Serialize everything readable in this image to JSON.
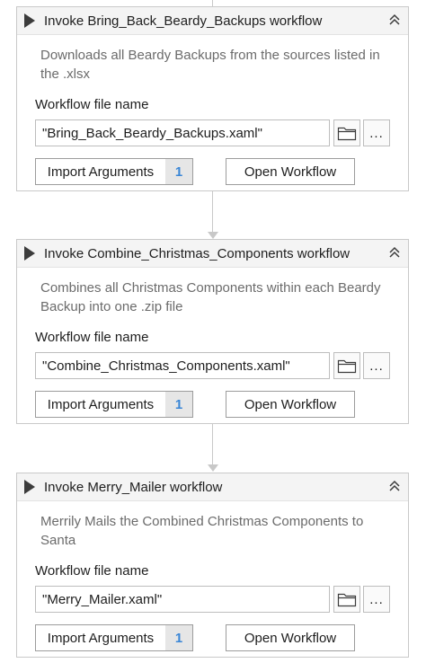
{
  "activities": [
    {
      "title": "Invoke Bring_Back_Beardy_Backups workflow",
      "description": "Downloads all Beardy Backups from the sources listed in the .xlsx",
      "field_label": "Workflow file name",
      "file_value": "\"Bring_Back_Beardy_Backups.xaml\"",
      "dots_label": "...",
      "import_label": "Import Arguments",
      "import_count": "1",
      "open_label": "Open Workflow"
    },
    {
      "title": "Invoke Combine_Christmas_Components workflow",
      "description": "Combines all Christmas Components within each Beardy Backup into one .zip file",
      "field_label": "Workflow file name",
      "file_value": "\"Combine_Christmas_Components.xaml\"",
      "dots_label": "...",
      "import_label": "Import Arguments",
      "import_count": "1",
      "open_label": "Open Workflow"
    },
    {
      "title": "Invoke Merry_Mailer workflow",
      "description": "Merrily Mails the Combined Christmas Components to Santa",
      "field_label": "Workflow file name",
      "file_value": "\"Merry_Mailer.xaml\"",
      "dots_label": "...",
      "import_label": "Import Arguments",
      "import_count": "1",
      "open_label": "Open Workflow"
    }
  ],
  "colors": {
    "accent_count": "#3a86d6",
    "connector": "#c8c8c8",
    "header_bg": "#f4f4f4"
  },
  "icons": [
    "play-icon",
    "collapse-icon",
    "folder-icon"
  ]
}
